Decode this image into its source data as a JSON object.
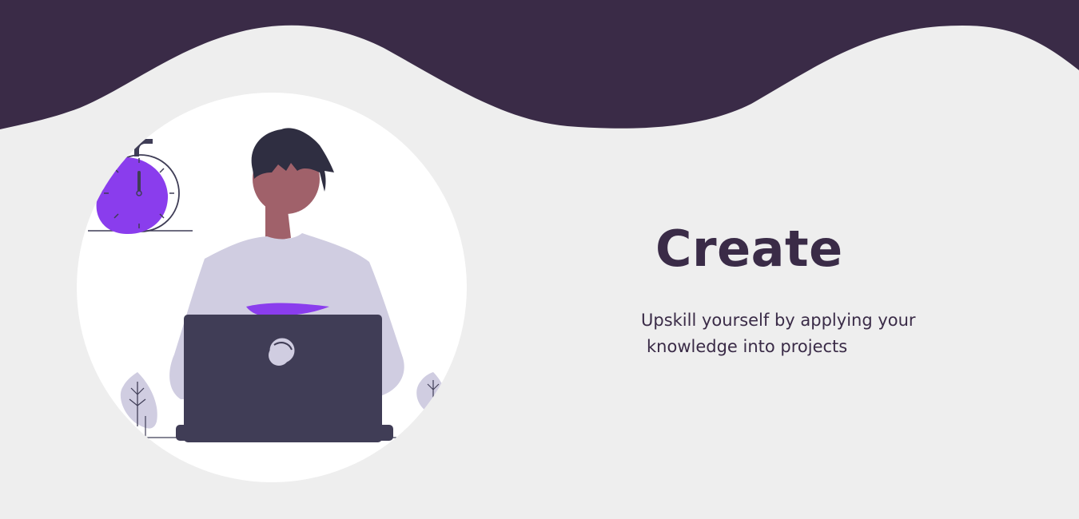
{
  "colors": {
    "background": "#eeeeee",
    "wave": "#3a2b47",
    "circle": "#ffffff",
    "text": "#3a2b47",
    "accent": "#8a3ded",
    "laptop": "#403d56",
    "shirt": "#d0cde1",
    "skin": "#a0616a",
    "hair": "#2f2e41"
  },
  "hero": {
    "title": "Create",
    "subtitle_line1": "Upskill yourself by applying your",
    "subtitle_line2": "knowledge into projects"
  },
  "illustration": {
    "icons": [
      "stopwatch-icon",
      "person-with-laptop",
      "leaf-plant-icon"
    ]
  }
}
